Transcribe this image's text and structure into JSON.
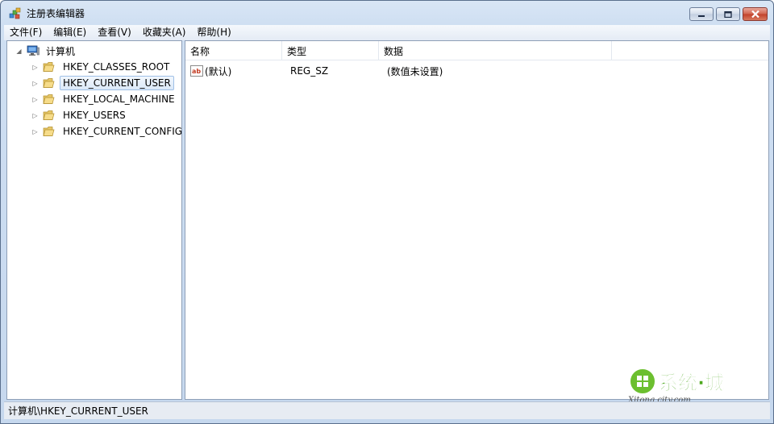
{
  "window": {
    "title": "注册表编辑器"
  },
  "menu": {
    "items": [
      "文件(F)",
      "编辑(E)",
      "查看(V)",
      "收藏夹(A)",
      "帮助(H)"
    ]
  },
  "tree": {
    "root": "计算机",
    "items": [
      {
        "label": "HKEY_CLASSES_ROOT",
        "selected": false
      },
      {
        "label": "HKEY_CURRENT_USER",
        "selected": true
      },
      {
        "label": "HKEY_LOCAL_MACHINE",
        "selected": false
      },
      {
        "label": "HKEY_USERS",
        "selected": false
      },
      {
        "label": "HKEY_CURRENT_CONFIG",
        "selected": false
      }
    ]
  },
  "list": {
    "columns": [
      "名称",
      "类型",
      "数据"
    ],
    "rows": [
      {
        "icon": "string-value-icon",
        "name": "(默认)",
        "type": "REG_SZ",
        "data": "(数值未设置)"
      }
    ]
  },
  "statusbar": {
    "path": "计算机\\HKEY_CURRENT_USER"
  },
  "watermark": {
    "text": "系统城",
    "domain": "Xitong city.com"
  },
  "colors": {
    "frame": "#c6d8ee",
    "selection": "#dbe9f8",
    "close_button": "#c1402a"
  }
}
